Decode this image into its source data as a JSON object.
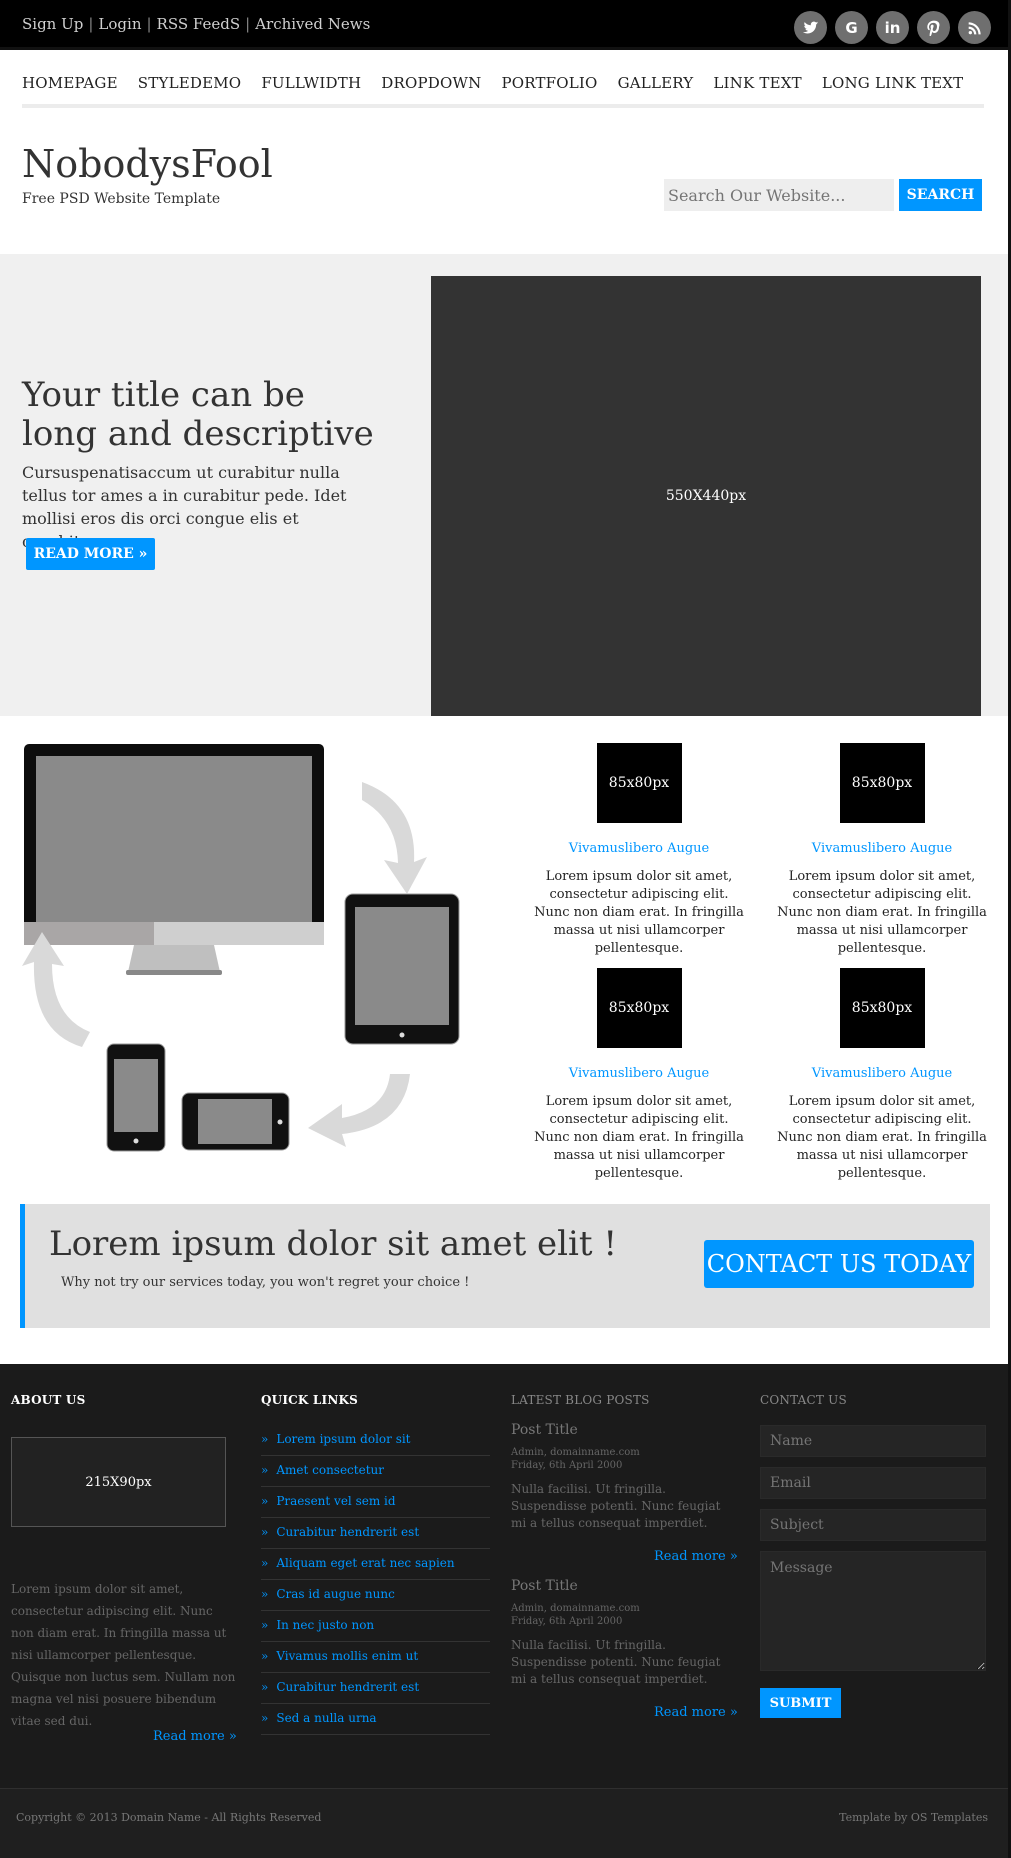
{
  "topbar": {
    "links": [
      "Sign Up",
      "Login",
      "RSS FeedS",
      "Archived News"
    ],
    "social_icons": [
      "twitter-icon",
      "google-icon",
      "linkedin-icon",
      "pinterest-icon",
      "rss-icon"
    ]
  },
  "nav": {
    "items": [
      "HOMEPAGE",
      "STYLEDEMO",
      "FULLWIDTH",
      "DROPDOWN",
      "PORTFOLIO",
      "GALLERY",
      "LINK TEXT",
      "LONG LINK TEXT"
    ]
  },
  "header": {
    "logo": "NobodysFool",
    "tagline": "Free PSD Website Template",
    "search_placeholder": "Search Our Website...",
    "search_button": "SEARCH"
  },
  "hero": {
    "title": "Your title can be long and descriptive",
    "text": "Cursuspenatisaccum ut curabitur nulla tellus tor ames a in curabitur pede. Idet mollisi eros dis orci congue elis et curabitur.",
    "button": "READ MORE  »",
    "image_label": "550X440px"
  },
  "features": [
    {
      "thumb": "85x80px",
      "title": "Vivamuslibero Augue",
      "text": "Lorem ipsum dolor sit amet, consectetur adipiscing elit. Nunc non diam erat. In fringilla massa ut nisi ullamcorper pellentesque."
    },
    {
      "thumb": "85x80px",
      "title": "Vivamuslibero Augue",
      "text": "Lorem ipsum dolor sit amet, consectetur adipiscing elit. Nunc non diam erat. In fringilla massa ut nisi ullamcorper pellentesque."
    },
    {
      "thumb": "85x80px",
      "title": "Vivamuslibero Augue",
      "text": "Lorem ipsum dolor sit amet, consectetur adipiscing elit. Nunc non diam erat. In fringilla massa ut nisi ullamcorper pellentesque."
    },
    {
      "thumb": "85x80px",
      "title": "Vivamuslibero Augue",
      "text": "Lorem ipsum dolor sit amet, consectetur adipiscing elit. Nunc non diam erat. In fringilla massa ut nisi ullamcorper pellentesque."
    }
  ],
  "cta": {
    "title": "Lorem ipsum dolor sit amet elit !",
    "subtitle": "Why not try our services today, you won't regret your choice !",
    "button": "CONTACT US TODAY"
  },
  "footer": {
    "about": {
      "heading": "ABOUT US",
      "image_label": "215X90px",
      "text": "Lorem ipsum dolor sit amet, consectetur adipiscing elit. Nunc non diam erat. In fringilla massa ut nisi ullamcorper pellentesque. Quisque non luctus sem. Nullam non magna vel nisi posuere bibendum vitae sed dui.",
      "read_more": "Read more »"
    },
    "quick_links": {
      "heading": "QUICK LINKS",
      "items": [
        "Lorem ipsum dolor sit",
        "Amet consectetur",
        "Praesent vel sem id",
        "Curabitur hendrerit est",
        "Aliquam eget erat nec sapien",
        "Cras id augue nunc",
        "In nec justo non",
        "Vivamus mollis enim ut",
        "Curabitur hendrerit est",
        "Sed a nulla urna"
      ]
    },
    "blog": {
      "heading": "LATEST BLOG POSTS",
      "posts": [
        {
          "title": "Post Title",
          "author": "Admin, domainname.com",
          "date": "Friday, 6th April 2000",
          "text": "Nulla facilisi. Ut fringilla. Suspendisse potenti. Nunc feugiat mi a tellus consequat imperdiet.",
          "read_more": "Read more »"
        },
        {
          "title": "Post Title",
          "author": "Admin, domainname.com",
          "date": "Friday, 6th April 2000",
          "text": "Nulla facilisi. Ut fringilla. Suspendisse potenti. Nunc feugiat mi a tellus consequat imperdiet.",
          "read_more": "Read more »"
        }
      ]
    },
    "contact": {
      "heading": "CONTACT US",
      "name_placeholder": "Name",
      "email_placeholder": "Email",
      "subject_placeholder": "Subject",
      "message_placeholder": "Message",
      "submit": "SUBMIT"
    },
    "copyright": "Copyright © 2013 Domain Name - All Rights Reserved",
    "credit": "Template by OS Templates"
  },
  "colors": {
    "accent": "#0096ff",
    "topbar": "#000000",
    "footer": "#1b1b1b",
    "hero_bg": "#f0f0f0"
  }
}
